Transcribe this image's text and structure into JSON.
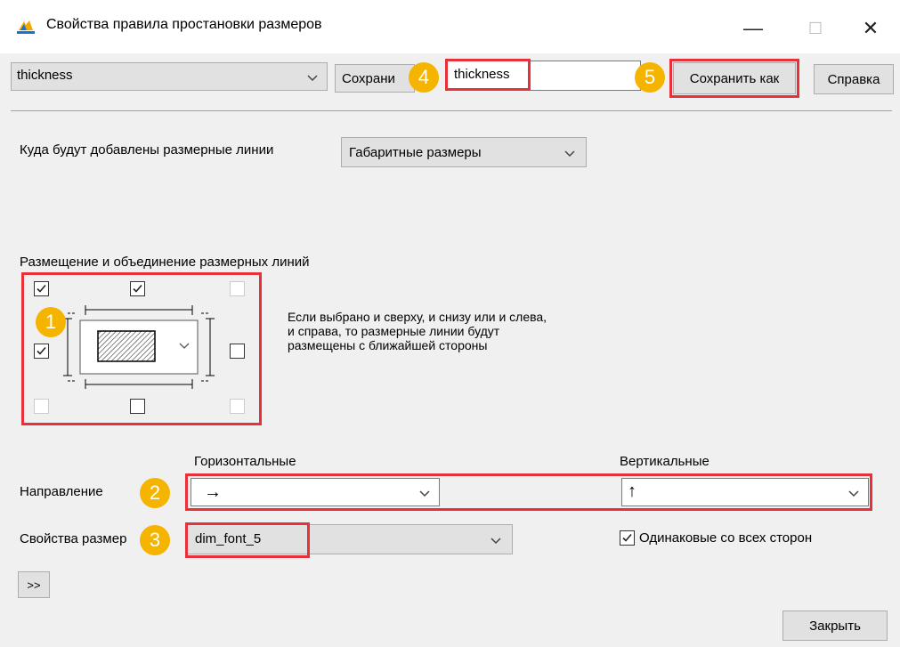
{
  "window": {
    "title": "Свойства правила простановки размеров",
    "minimize": "—",
    "maximize": "☐",
    "close": "✕"
  },
  "toolbar": {
    "rule_select": "thickness",
    "save_button": "Сохрани",
    "name_input": "thickness",
    "save_as_button": "Сохранить как",
    "help_button": "Справка"
  },
  "target": {
    "label": "Куда будут добавлены размерные линии",
    "value": "Габаритные размеры"
  },
  "placement": {
    "label": "Размещение и объединение размерных линий",
    "checkboxes": {
      "top_left": true,
      "top_center": true,
      "top_right": false,
      "left": true,
      "right": false,
      "bottom_left": false,
      "bottom_center": false,
      "bottom_right": false
    },
    "hint_lines": [
      "Если выбрано и сверху, и снизу или и слева,",
      "и справа, то размерные линии будут",
      "размещены с ближайшей стороны"
    ]
  },
  "direction": {
    "label": "Направление",
    "horizontal_header": "Горизонтальные",
    "vertical_header": "Вертикальные",
    "horizontal_value": "→",
    "vertical_value": "↑"
  },
  "dim_props": {
    "label": "Свойства размер",
    "value": "dim_font_5",
    "same_all_sides": "Одинаковые со всех сторон",
    "same_all_sides_checked": true
  },
  "expand_button": ">>",
  "close_button": "Закрыть",
  "badges": [
    "1",
    "2",
    "3",
    "4",
    "5"
  ],
  "colors": {
    "highlight": "#e8303a",
    "badge": "#f4b400"
  }
}
